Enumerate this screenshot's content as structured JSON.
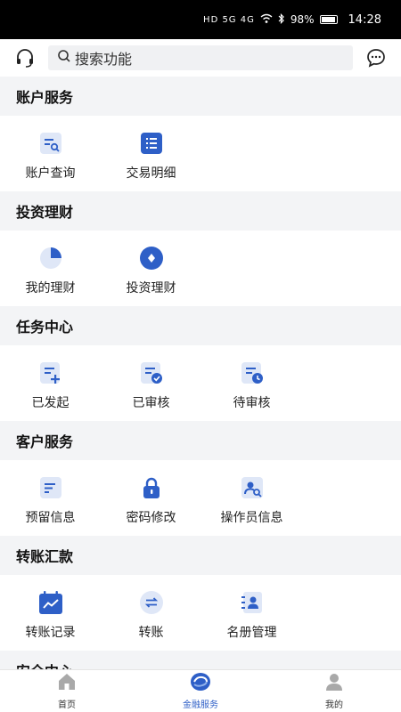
{
  "status_bar": {
    "signal_text": "HD 5G 4G",
    "battery": "98%",
    "time": "14:28"
  },
  "header": {
    "search_placeholder": "搜索功能",
    "left_icon": "headset-icon",
    "right_icon": "chat-bubble-icon"
  },
  "sections": [
    {
      "title": "账户服务",
      "items": [
        {
          "label": "账户查询",
          "icon": "account-search-icon"
        },
        {
          "label": "交易明细",
          "icon": "transaction-list-icon"
        }
      ]
    },
    {
      "title": "投资理财",
      "items": [
        {
          "label": "我的理财",
          "icon": "pie-chart-icon"
        },
        {
          "label": "投资理财",
          "icon": "coin-icon"
        }
      ]
    },
    {
      "title": "任务中心",
      "items": [
        {
          "label": "已发起",
          "icon": "doc-plus-icon"
        },
        {
          "label": "已审核",
          "icon": "doc-check-icon"
        },
        {
          "label": "待审核",
          "icon": "doc-clock-icon"
        }
      ]
    },
    {
      "title": "客户服务",
      "items": [
        {
          "label": "预留信息",
          "icon": "doc-lines-icon"
        },
        {
          "label": "密码修改",
          "icon": "lock-icon"
        },
        {
          "label": "操作员信息",
          "icon": "operator-search-icon"
        }
      ]
    },
    {
      "title": "转账汇款",
      "items": [
        {
          "label": "转账记录",
          "icon": "calendar-chart-icon"
        },
        {
          "label": "转账",
          "icon": "transfer-icon"
        },
        {
          "label": "名册管理",
          "icon": "contacts-book-icon"
        }
      ]
    },
    {
      "title": "安全中心",
      "items": []
    }
  ],
  "bottom_nav": [
    {
      "label": "首页",
      "icon": "home-icon",
      "active": false
    },
    {
      "label": "金融服务",
      "icon": "finance-logo-icon",
      "active": true
    },
    {
      "label": "我的",
      "icon": "person-icon",
      "active": false
    }
  ],
  "colors": {
    "accent": "#2e5fc7",
    "light_accent": "#dfe7f7",
    "background": "#f3f4f6"
  }
}
